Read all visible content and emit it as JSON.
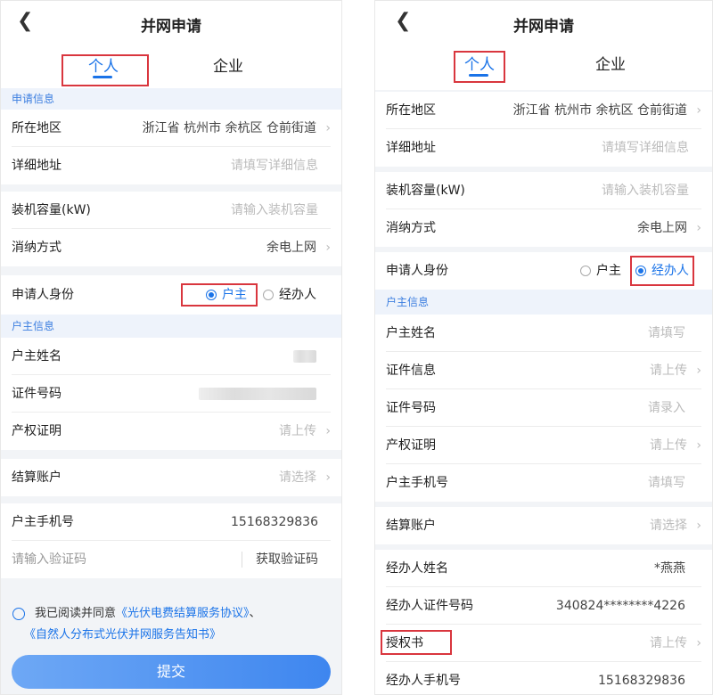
{
  "common": {
    "back_icon": "chevron-left-icon",
    "title": "并网申请",
    "tab_personal": "个人",
    "tab_enterprise": "企业",
    "arrow": "›",
    "accent": "#1a73e8",
    "highlight": "#d9363e"
  },
  "left": {
    "section_apply": "申请信息",
    "region_label": "所在地区",
    "region_value": "浙江省 杭州市 余杭区 仓前街道",
    "address_label": "详细地址",
    "address_placeholder": "请填写详细信息",
    "capacity_label": "装机容量(kW)",
    "capacity_placeholder": "请输入装机容量",
    "consume_label": "消纳方式",
    "consume_value": "余电上网",
    "identity_label": "申请人身份",
    "identity_owner": "户主",
    "identity_agent": "经办人",
    "identity_selected": "户主",
    "section_owner": "户主信息",
    "owner_name_label": "户主姓名",
    "id_number_label": "证件号码",
    "property_label": "产权证明",
    "property_placeholder": "请上传",
    "account_label": "结算账户",
    "account_placeholder": "请选择",
    "phone_label": "户主手机号",
    "phone_value": "15168329836",
    "code_placeholder": "请输入验证码",
    "code_button": "获取验证码",
    "agree_prefix": "我已阅读并同意",
    "agree_link1": "《光伏电费结算服务协议》",
    "agree_sep": "、",
    "agree_link2": "《自然人分布式光伏并网服务告知书》",
    "submit": "提交"
  },
  "right": {
    "region_label": "所在地区",
    "region_value": "浙江省 杭州市 余杭区 仓前街道",
    "address_label": "详细地址",
    "address_placeholder": "请填写详细信息",
    "capacity_label": "装机容量(kW)",
    "capacity_placeholder": "请输入装机容量",
    "consume_label": "消纳方式",
    "consume_value": "余电上网",
    "identity_label": "申请人身份",
    "identity_owner": "户主",
    "identity_agent": "经办人",
    "identity_selected": "经办人",
    "section_owner": "户主信息",
    "owner_name_label": "户主姓名",
    "owner_name_placeholder": "请填写",
    "cert_label": "证件信息",
    "cert_placeholder": "请上传",
    "id_number_label": "证件号码",
    "id_number_placeholder": "请录入",
    "property_label": "产权证明",
    "property_placeholder": "请上传",
    "owner_phone_label": "户主手机号",
    "owner_phone_placeholder": "请填写",
    "account_label": "结算账户",
    "account_placeholder": "请选择",
    "agent_name_label": "经办人姓名",
    "agent_name_value": "*燕燕",
    "agent_id_label": "经办人证件号码",
    "agent_id_value": "340824********4226",
    "auth_label": "授权书",
    "auth_placeholder": "请上传",
    "agent_phone_label": "经办人手机号",
    "agent_phone_value": "15168329836"
  }
}
